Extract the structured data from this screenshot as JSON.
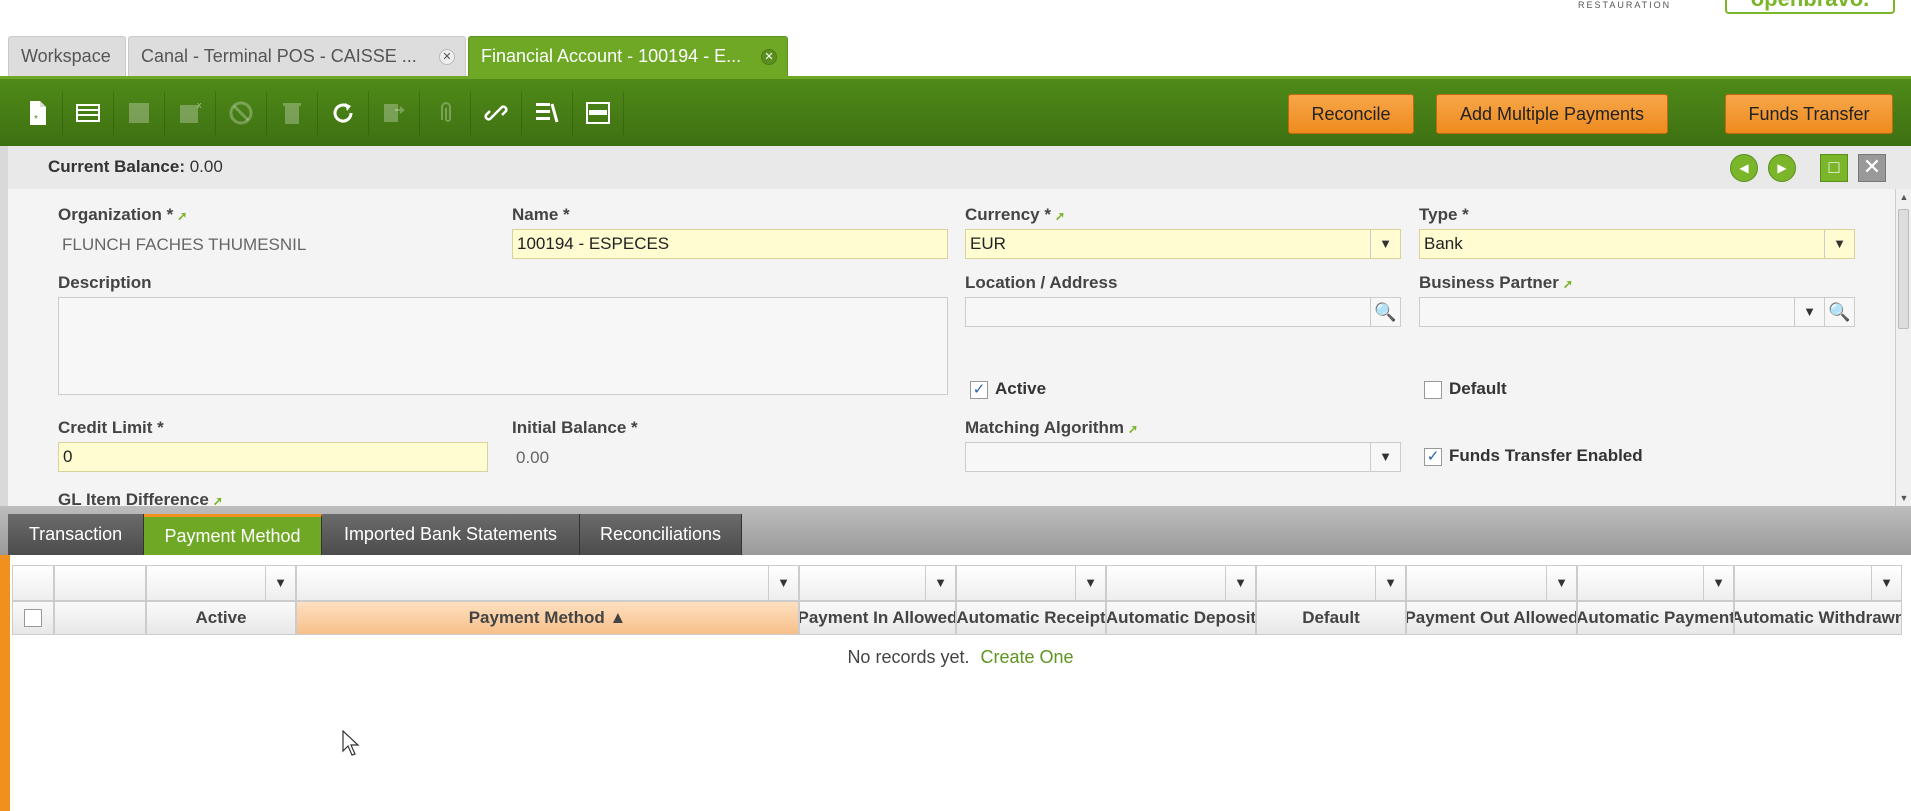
{
  "brand": {
    "restauration": "RESTAURATION",
    "logo": "openbravo."
  },
  "window_tabs": [
    {
      "label": "Workspace",
      "closable": false,
      "active": false
    },
    {
      "label": "Canal - Terminal POS - CAISSE ...",
      "closable": true,
      "active": false
    },
    {
      "label": "Financial Account - 100194 - E...",
      "closable": true,
      "active": true
    }
  ],
  "toolbar": {
    "icons": [
      "new-document-icon",
      "new-row-icon",
      "save-icon",
      "save-close-icon",
      "undo-icon",
      "delete-icon",
      "refresh-icon",
      "export-icon",
      "attachment-icon",
      "link-icon",
      "tools-icon",
      "grid-view-icon"
    ],
    "reconcile_label": "Reconcile",
    "add_multiple_payments_label": "Add Multiple Payments",
    "funds_transfer_label": "Funds Transfer"
  },
  "header": {
    "current_balance_label": "Current Balance:",
    "current_balance_value": "0.00"
  },
  "form": {
    "organization_label": "Organization *",
    "organization_value": "FLUNCH FACHES THUMESNIL",
    "name_label": "Name *",
    "name_value": "100194 - ESPECES",
    "currency_label": "Currency *",
    "currency_value": "EUR",
    "type_label": "Type *",
    "type_value": "Bank",
    "description_label": "Description",
    "description_value": "",
    "location_label": "Location / Address",
    "location_value": "",
    "business_partner_label": "Business Partner",
    "business_partner_value": "",
    "active_label": "Active",
    "active_checked": true,
    "default_label": "Default",
    "default_checked": false,
    "credit_limit_label": "Credit Limit *",
    "credit_limit_value": "0",
    "initial_balance_label": "Initial Balance *",
    "initial_balance_value": "0.00",
    "matching_algorithm_label": "Matching Algorithm",
    "matching_algorithm_value": "",
    "funds_transfer_enabled_label": "Funds Transfer Enabled",
    "funds_transfer_enabled_checked": true,
    "gl_item_difference_label": "GL Item Difference"
  },
  "sub_tabs": [
    {
      "label": "Transaction",
      "active": false
    },
    {
      "label": "Payment Method",
      "active": true
    },
    {
      "label": "Imported Bank Statements",
      "active": false
    },
    {
      "label": "Reconciliations",
      "active": false
    }
  ],
  "grid": {
    "columns": [
      "Active",
      "Payment Method ▲",
      "Payment In Allowed",
      "Automatic Receipt",
      "Automatic Deposit",
      "Default",
      "Payment Out Allowed",
      "Automatic Payment",
      "Automatic Withdrawn"
    ],
    "empty_text": "No records yet.",
    "create_link": "Create One"
  }
}
